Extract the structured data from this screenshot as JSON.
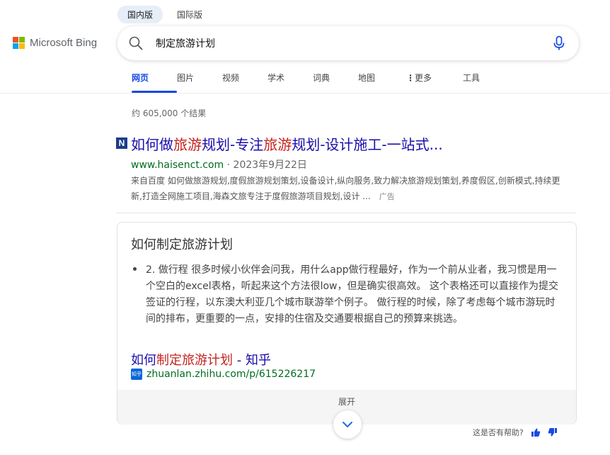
{
  "region_tabs": [
    "国内版",
    "国际版"
  ],
  "logo": {
    "text": "Microsoft Bing",
    "colors": [
      "#f25022",
      "#7fba00",
      "#00a4ef",
      "#ffb900"
    ]
  },
  "search": {
    "query": "制定旅游计划",
    "icon": "search-icon",
    "mic_icon": "microphone-icon"
  },
  "nav": {
    "items": [
      "网页",
      "图片",
      "视频",
      "学术",
      "词典",
      "地图",
      "更多",
      "工具"
    ],
    "active": "网页",
    "more_icon": "vertical-dots-icon"
  },
  "results_count": "约 605,000 个结果",
  "ad_result": {
    "favicon_letter": "N",
    "title_parts": [
      "如何做",
      "旅游",
      "规划-专注",
      "旅游",
      "规划-设计施工-一站式..."
    ],
    "site": "www.haisenct.com",
    "separator": "·",
    "date": "2023年9月22日",
    "snippet": "来自百度 如何做旅游规划,度假旅游规划策划,设备设计,纵向服务,致力解决旅游规划策划,养度假区,创新模式,持续更新,打造全网施工项目,海森文旅专注于度假旅游项目规划,设计 ...",
    "ad_label": "广告"
  },
  "answer_card": {
    "title": "如何制定旅游计划",
    "bullet_text": "2. 做行程 很多时候小伙伴会问我，用什么app做行程最好，作为一个前从业者，我习惯是用一个空白的excel表格，听起来这个方法很low，但是确实很高效。 这个表格还可以直接作为提交签证的行程，以东澳大利亚几个城市联游举个例子。 做行程的时候，除了考虑每个城市游玩时间的排布，更重要的一点，安排的住宿及交通要根据自己的预算来挑选。",
    "link_parts": [
      "如何",
      "制定旅游计划",
      " - 知乎"
    ],
    "source_icon_text": "知乎",
    "url": "zhuanlan.zhihu.com/p/615226217",
    "expand_label": "展开",
    "expand_icon": "chevron-down-icon"
  },
  "feedback": {
    "label": "这是否有帮助?",
    "up_icon": "thumbs-up-icon",
    "down_icon": "thumbs-down-icon"
  },
  "colors": {
    "link": "#1a0dab",
    "highlight": "#c5221f",
    "url_green": "#006d21",
    "accent": "#174ae4"
  }
}
